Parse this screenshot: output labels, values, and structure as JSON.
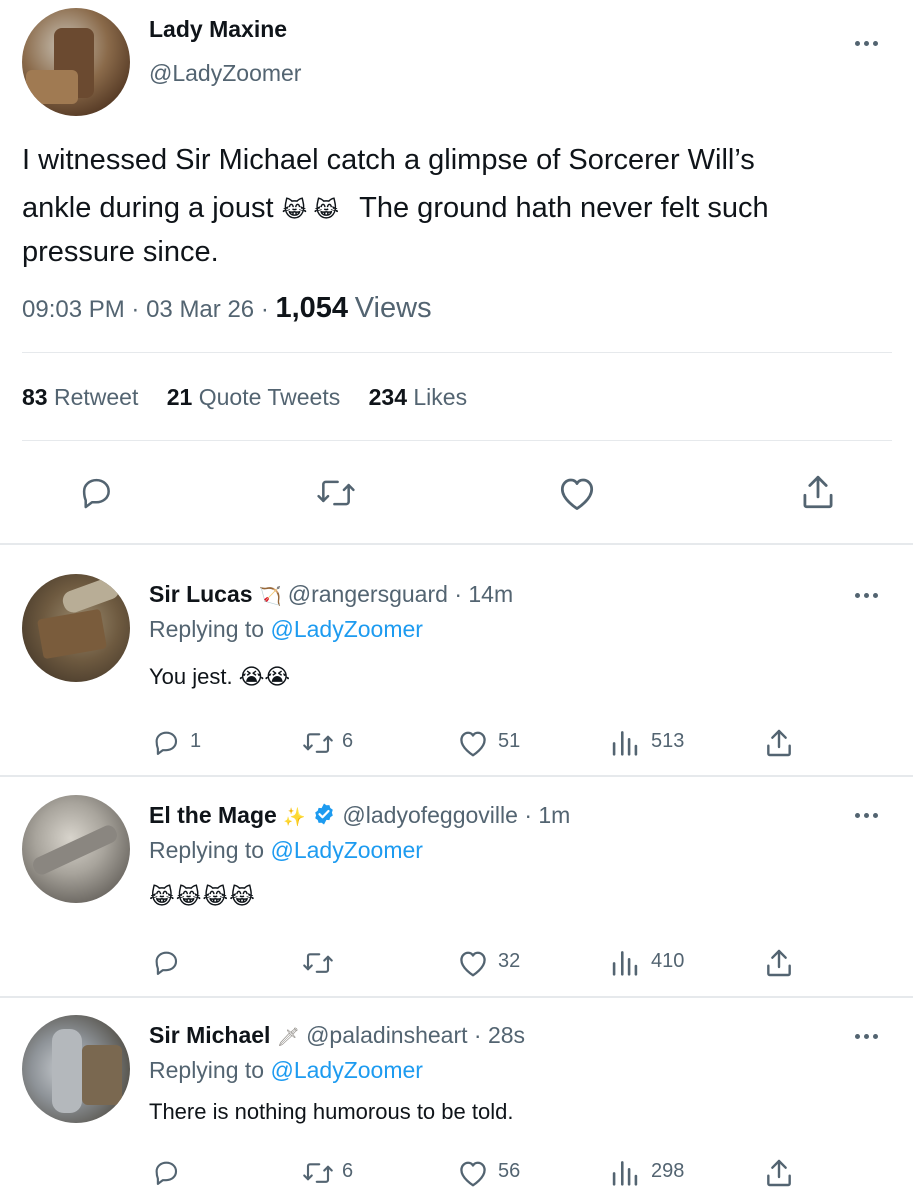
{
  "main": {
    "author_name": "Lady Maxine",
    "author_handle": "@LadyZoomer",
    "text_line1": "I witnessed Sir Michael catch a glimpse of Sorcerer Will’s",
    "text_line2_a": "ankle during a joust",
    "text_line2_emoji": "😹 😹",
    "text_line2_b": "The ground hath never felt such",
    "text_line3": "pressure since.",
    "time": "09:03 PM",
    "sep": "·",
    "date": "03 Mar 26",
    "views_count": "1,054",
    "views_label": "Views",
    "retweets_count": "83",
    "retweets_label": "Retweet",
    "quotes_count": "21",
    "quotes_label": "Quote Tweets",
    "likes_count": "234",
    "likes_label": "Likes"
  },
  "replies": [
    {
      "name": "Sir Lucas",
      "name_emoji": "🏹",
      "handle": "@rangersguard",
      "time": "· 14m",
      "replying_prefix": "Replying to",
      "replying_handle": "@LadyZoomer",
      "text": "You jest. 😭😭",
      "reply_count": "1",
      "retweet_count": "6",
      "like_count": "51",
      "view_count": "513"
    },
    {
      "name": "El the Mage",
      "name_emoji": "✨",
      "handle": "@ladyofeggoville",
      "time": "· 1m",
      "replying_prefix": "Replying to",
      "replying_handle": "@LadyZoomer",
      "text": "😹😹😹😹",
      "reply_count": "",
      "retweet_count": "",
      "like_count": "32",
      "view_count": "410"
    },
    {
      "name": "Sir Michael",
      "name_emoji": "🗡",
      "handle": "@paladinsheart",
      "time": "· 28s",
      "replying_prefix": "Replying to",
      "replying_handle": "@LadyZoomer",
      "text": "There is nothing humorous to be told.",
      "reply_count": "",
      "retweet_count": "6",
      "like_count": "56",
      "view_count": "298"
    }
  ],
  "colors": {
    "accent": "#1d9bf0",
    "secondary_text": "#536471",
    "divider": "#e6e9ec"
  }
}
